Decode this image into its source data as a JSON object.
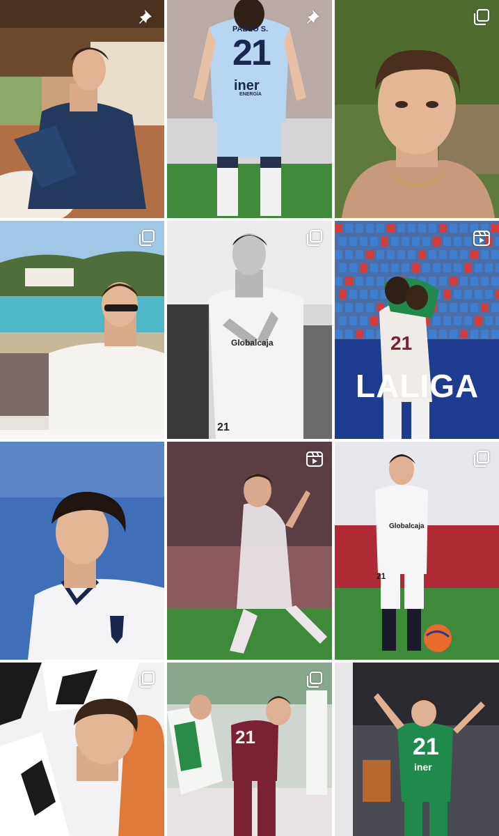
{
  "grid": {
    "posts": [
      {
        "id_label": "post-1",
        "kind": "pinned",
        "badge_icon": "pin-icon",
        "scene": "man-restaurant-navy-shirt"
      },
      {
        "id_label": "post-2",
        "kind": "pinned",
        "badge_icon": "pin-icon",
        "scene": "player-back-21",
        "jersey_name": "PABLO S.",
        "jersey_number": "21",
        "sponsor": "iner",
        "sponsor_sub": "ENERGÍA"
      },
      {
        "id_label": "post-3",
        "kind": "carousel",
        "badge_icon": "carousel-icon",
        "scene": "selfie-closeup"
      },
      {
        "id_label": "post-4",
        "kind": "carousel",
        "badge_icon": "carousel-icon",
        "scene": "beach-white-shirt"
      },
      {
        "id_label": "post-5",
        "kind": "carousel",
        "badge_icon": "carousel-icon",
        "scene": "bw-player-applauding",
        "shirt_text": "Globalcaja",
        "shirt_number": "21"
      },
      {
        "id_label": "post-6",
        "kind": "reel",
        "badge_icon": "reel-icon",
        "scene": "stadium-hug",
        "board_text": "LALIGA",
        "jersey_number": "21"
      },
      {
        "id_label": "post-7",
        "kind": "none",
        "badge_icon": "",
        "scene": "profile-portrait-blue"
      },
      {
        "id_label": "post-8",
        "kind": "reel",
        "badge_icon": "reel-icon",
        "scene": "motion-blur-player"
      },
      {
        "id_label": "post-9",
        "kind": "carousel",
        "badge_icon": "carousel-icon",
        "scene": "player-with-ball",
        "shirt_text": "Globalcaja",
        "shirt_number": "21"
      },
      {
        "id_label": "post-10",
        "kind": "carousel",
        "badge_icon": "carousel-icon",
        "scene": "team-huddle"
      },
      {
        "id_label": "post-11",
        "kind": "carousel",
        "badge_icon": "carousel-icon",
        "scene": "match-maroon-vs-white",
        "jersey_number": "21"
      },
      {
        "id_label": "post-12",
        "kind": "none",
        "badge_icon": "",
        "scene": "green-kit-celebration",
        "jersey_number": "21",
        "sponsor": "iner"
      }
    ]
  },
  "colors": {
    "pitch_green": "#3e8a3a",
    "sky_blue": "#9ec8e6",
    "navy_shirt": "#233a5e",
    "maroon": "#7a2233",
    "kit_green": "#1f8a4c",
    "laliga_blue": "#1d3b8f"
  }
}
